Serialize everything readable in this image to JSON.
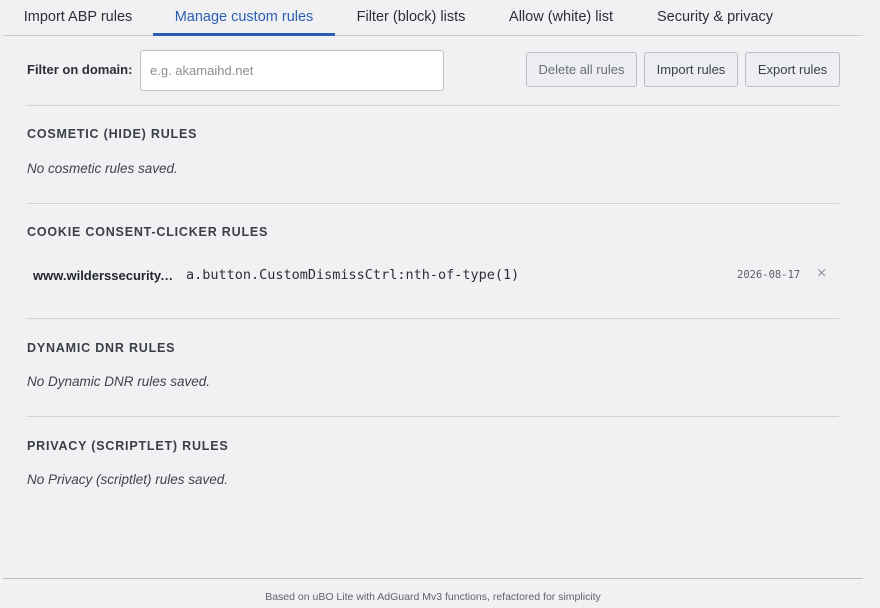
{
  "tabs": [
    {
      "label": "Import ABP rules"
    },
    {
      "label": "Manage custom rules"
    },
    {
      "label": "Filter (block) lists"
    },
    {
      "label": "Allow (white) list"
    },
    {
      "label": "Security & privacy"
    }
  ],
  "active_tab": "Manage custom rules",
  "filter": {
    "label": "Filter on domain:",
    "placeholder": "e.g. akamaihd.net",
    "value": ""
  },
  "toolbar": {
    "delete_all_label": "Delete all rules",
    "import_label": "Import rules",
    "export_label": "Export rules"
  },
  "sections": {
    "cosmetic": {
      "title": "COSMETIC (HIDE) RULES",
      "empty": "No cosmetic rules saved."
    },
    "cookie": {
      "title": "COOKIE CONSENT-CLICKER RULES",
      "rules": [
        {
          "domain": "www.wilderssecurity.com",
          "selector": "a.button.CustomDismissCtrl:nth-of-type(1)",
          "date": "2026-08-17",
          "remove": "×"
        }
      ]
    },
    "dnr": {
      "title": "DYNAMIC DNR RULES",
      "empty": "No Dynamic DNR rules saved."
    },
    "privacy": {
      "title": "PRIVACY (SCRIPTLET) RULES",
      "empty": "No Privacy (scriptlet) rules saved."
    }
  },
  "footer": {
    "text": "Based on uBO Lite with AdGuard Mv3 functions, refactored for simplicity"
  },
  "colors": {
    "accent": "#2a5fb3",
    "background": "#f1f1f3"
  }
}
